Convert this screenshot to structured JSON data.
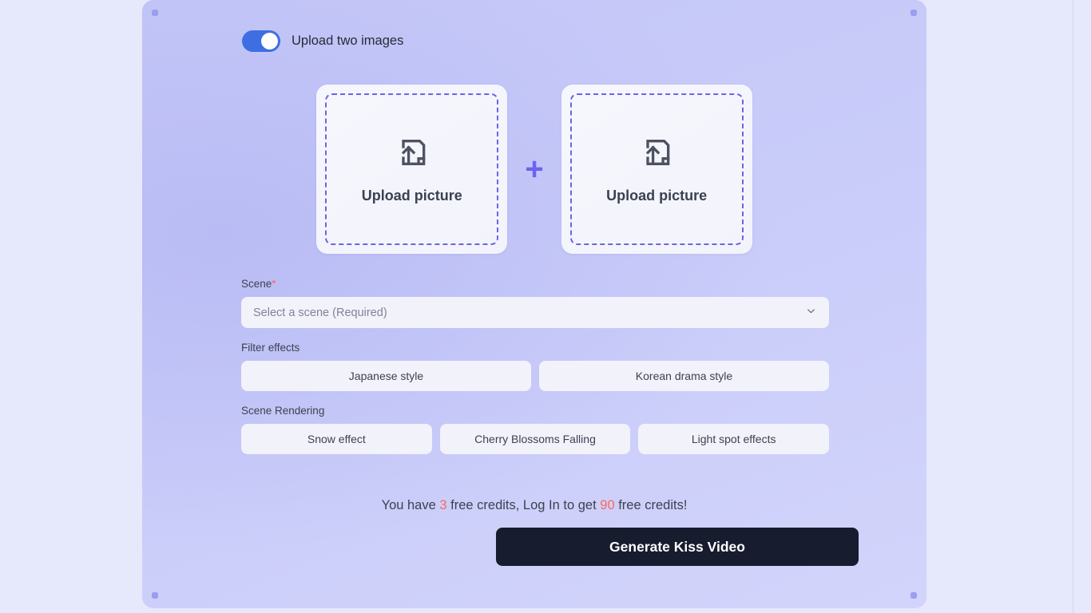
{
  "toggle": {
    "label": "Upload two images",
    "state": "on"
  },
  "upload": {
    "cards": [
      {
        "label": "Upload picture",
        "icon": "file-upload-icon"
      },
      {
        "label": "Upload picture",
        "icon": "file-upload-icon"
      }
    ],
    "separator": "+"
  },
  "scene": {
    "label": "Scene",
    "required_marker": "*",
    "placeholder": "Select a scene (Required)",
    "selected": "",
    "chevron": "chevron-down-icon"
  },
  "filter_effects": {
    "label": "Filter effects",
    "options": [
      "Japanese style",
      "Korean drama style"
    ]
  },
  "scene_rendering": {
    "label": "Scene Rendering",
    "options": [
      "Snow effect",
      "Cherry Blossoms Falling",
      "Light spot effects"
    ]
  },
  "credits": {
    "prefix": "You have ",
    "free_credits": "3",
    "middle": " free credits, Log In to get ",
    "login_credits": "90",
    "suffix": " free credits!"
  },
  "generate": {
    "label": "Generate Kiss Video"
  },
  "colors": {
    "toggle_on": "#3d6fe2",
    "accent_purple": "#6c63f0",
    "required_red": "#f2685c",
    "credit_red": "#fa6a5e",
    "button_dark": "#171c2e",
    "panel_bg": "#c4c7f7",
    "page_bg": "#e6e8fb"
  }
}
